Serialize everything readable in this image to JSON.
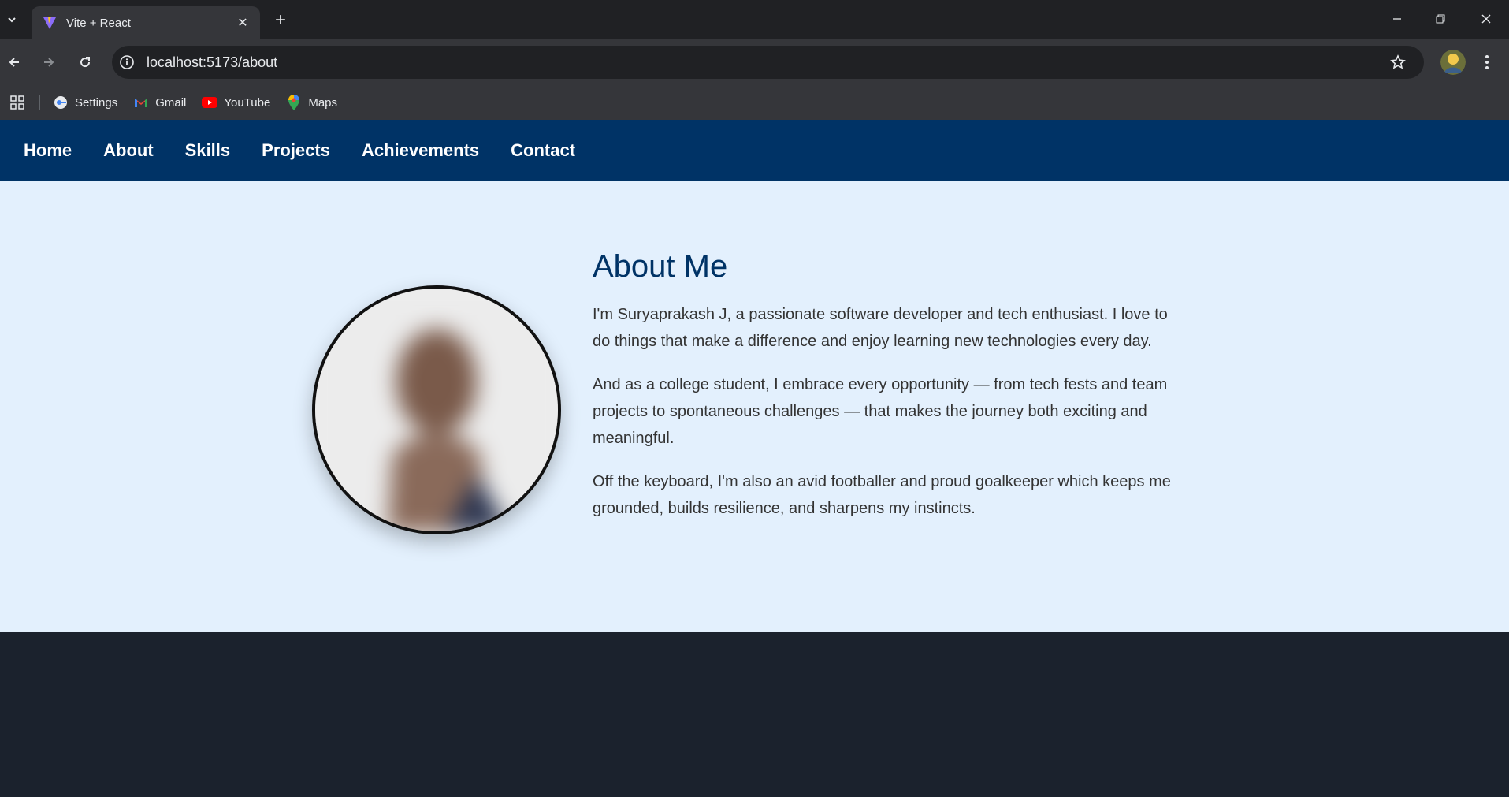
{
  "browser": {
    "tab": {
      "title": "Vite + React",
      "close": "✕"
    },
    "new_tab": "+",
    "url": "localhost:5173/about",
    "bookmarks": [
      {
        "label": "Settings",
        "icon": "settings-icon"
      },
      {
        "label": "Gmail",
        "icon": "gmail-icon"
      },
      {
        "label": "YouTube",
        "icon": "youtube-icon"
      },
      {
        "label": "Maps",
        "icon": "maps-icon"
      }
    ]
  },
  "nav": {
    "items": [
      "Home",
      "About",
      "Skills",
      "Projects",
      "Achievements",
      "Contact"
    ]
  },
  "about": {
    "heading": "About Me",
    "paragraphs": [
      "I'm Suryaprakash J, a passionate software developer and tech enthusiast. I love to do things that make a difference and enjoy learning new technologies every day.",
      "And as a college student, I embrace every opportunity — from tech fests and team projects to spontaneous challenges — that makes the journey both exciting and meaningful.",
      "Off the keyboard, I'm also an avid footballer and proud goalkeeper which keeps me grounded, builds resilience, and sharpens my instincts."
    ]
  },
  "colors": {
    "nav_bg": "#003366",
    "section_bg": "#e3f0fd",
    "heading": "#003366",
    "footer_bg": "#1b222d"
  }
}
